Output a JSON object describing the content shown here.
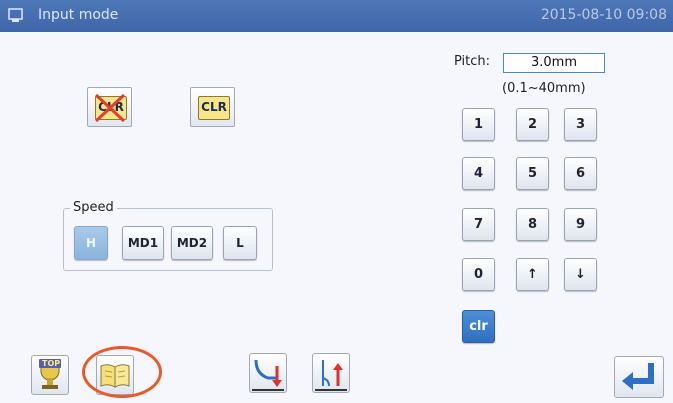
{
  "window": {
    "title": "Input mode",
    "clock": "2015-08-10 09:08"
  },
  "icons": {
    "clear_disabled": "clr-crossed-folder-icon",
    "clear": "clr-folder-icon",
    "top": "top-trophy-icon",
    "book": "book-icon",
    "needle_down": "needle-down-icon",
    "needle_up": "needle-up-icon",
    "enter": "enter-return-icon"
  },
  "clear_buttons": {
    "disabled_label": "CLR",
    "enabled_label": "CLR"
  },
  "pitch": {
    "label": "Pitch:",
    "value": "3.0mm",
    "range": "(0.1~40mm)"
  },
  "keypad": {
    "keys": [
      "1",
      "2",
      "3",
      "4",
      "5",
      "6",
      "7",
      "8",
      "9",
      "0",
      "↑",
      "↓"
    ],
    "clear_label": "clr"
  },
  "speed": {
    "label": "Speed",
    "options": [
      "H",
      "MD1",
      "MD2",
      "L"
    ],
    "selected": "H"
  },
  "bottom_bar": {
    "top_label": "TOP"
  },
  "colors": {
    "titlebar": "#4672b4",
    "highlight_circle": "#e85a2a",
    "accent": "#2e6fbf"
  }
}
